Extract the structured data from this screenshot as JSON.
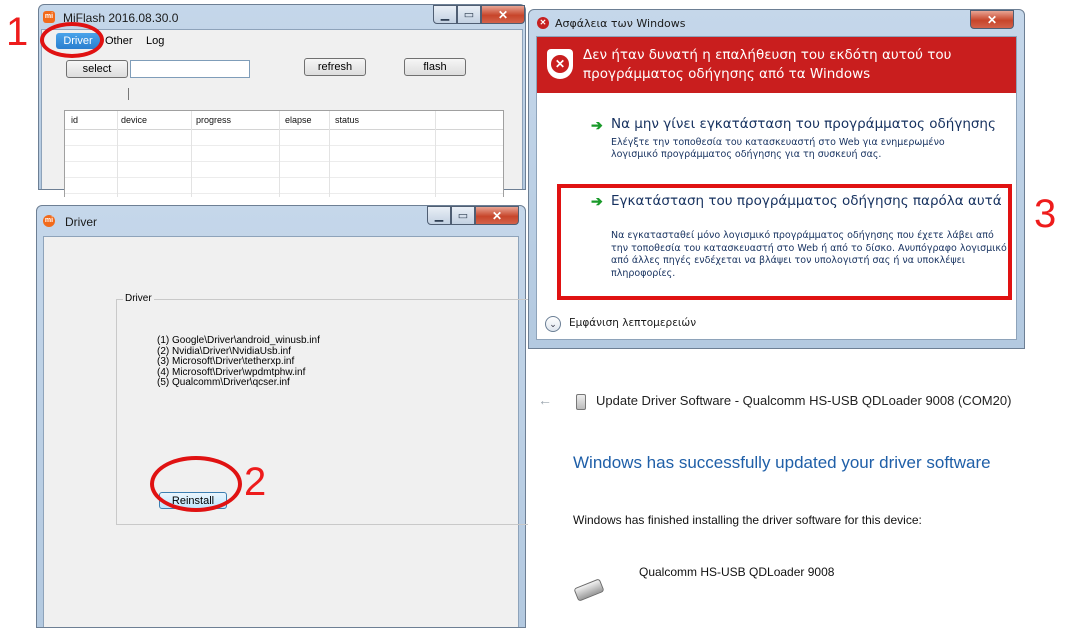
{
  "annotations": {
    "n1": "1",
    "n2": "2",
    "n3": "3"
  },
  "mflash": {
    "title": "MiFlash 2016.08.30.0",
    "menu": [
      "Driver",
      "Other",
      "Log"
    ],
    "select_button": "select",
    "path_value": "",
    "refresh_button": "refresh",
    "flash_button": "flash",
    "columns": [
      "id",
      "device",
      "progress",
      "elapse",
      "status"
    ]
  },
  "driver_window": {
    "title": "Driver",
    "group_label": "Driver",
    "files": [
      "(1) Google\\Driver\\android_winusb.inf",
      "(2) Nvidia\\Driver\\NvidiaUsb.inf",
      "(3) Microsoft\\Driver\\tetherxp.inf",
      "(4) Microsoft\\Driver\\wpdmtphw.inf",
      "(5) Qualcomm\\Driver\\qcser.inf"
    ],
    "reinstall_button": "Reinstall"
  },
  "security_dialog": {
    "title": "Ασφάλεια των Windows",
    "header_text": "Δεν ήταν δυνατή η επαλήθευση του εκδότη αυτού του προγράμματος οδήγησης από τα Windows",
    "option1_title": "Να μην γίνει εγκατάσταση του προγράμματος οδήγησης",
    "option1_desc": "Ελέγξτε την τοποθεσία του κατασκευαστή στο Web για ενημερωμένο λογισμικό προγράμματος οδήγησης για τη συσκευή σας.",
    "option2_title": "Εγκατάσταση του προγράμματος οδήγησης παρόλα αυτά",
    "option2_desc": "Να εγκατασταθεί μόνο λογισμικό προγράμματος οδήγησης που έχετε λάβει από την τοποθεσία του κατασκευαστή στο Web ή από το δίσκο. Ανυπόγραφο λογισμικό από άλλες πηγές ενδέχεται να βλάψει τον υπολογιστή σας ή να υποκλέψει πληροφορίες.",
    "details_label": "Εμφάνιση λεπτομερειών"
  },
  "update_panel": {
    "title": "Update Driver Software - Qualcomm HS-USB QDLoader 9008 (COM20)",
    "success_heading": "Windows has successfully updated your driver software",
    "finished_text": "Windows has finished installing the driver software for this device:",
    "device_name": "Qualcomm HS-USB QDLoader 9008"
  },
  "colors": {
    "accent_red": "#ee1c1c",
    "win_blue": "#1f5fa8",
    "link_blue": "#16315f",
    "header_red": "#c91e1e"
  }
}
